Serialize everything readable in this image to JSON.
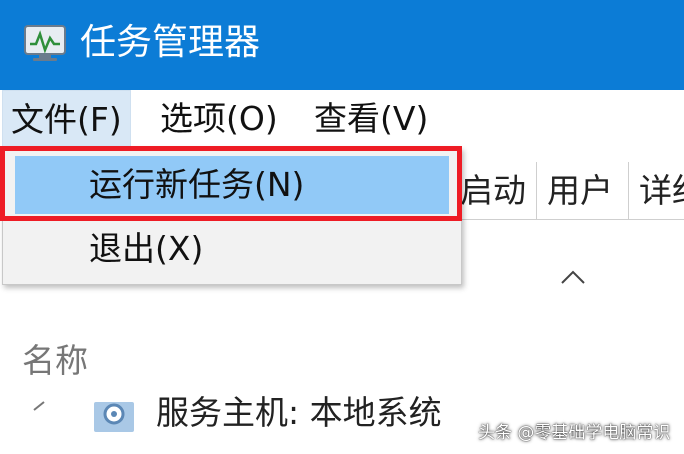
{
  "window": {
    "title": "任务管理器",
    "icon": "task-manager-icon"
  },
  "menubar": {
    "items": [
      {
        "label": "文件(F)"
      },
      {
        "label": "选项(O)"
      },
      {
        "label": "查看(V)"
      }
    ]
  },
  "file_menu": {
    "items": [
      {
        "label": "运行新任务(N)",
        "highlighted": true
      },
      {
        "label": "退出(X)",
        "highlighted": false
      }
    ]
  },
  "tabs": [
    {
      "label": "启动"
    },
    {
      "label": "用户"
    },
    {
      "label": "详细"
    }
  ],
  "table": {
    "name_header": "名称",
    "rows": [
      {
        "label": "服务主机: 本地系统",
        "icon": "gear-icon"
      }
    ]
  },
  "watermark": "头条 @零基础学电脑常识",
  "colors": {
    "titlebar": "#0c7cd6",
    "highlight": "#91c9f7",
    "annotation": "#ee1c25"
  }
}
